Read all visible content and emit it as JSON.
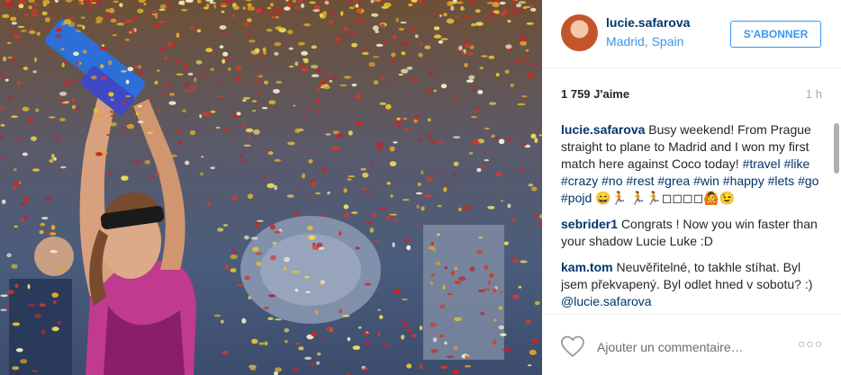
{
  "post": {
    "photo_alt": "",
    "username": "lucie.safarova",
    "location": "Madrid, Spain",
    "follow_label": "S'ABONNER",
    "likes": "1 759 J'aime",
    "time": "1 h"
  },
  "comments": [
    {
      "user": "lucie.safarova",
      "text_before": "Busy weekend! From Prague straight to plane to Madrid and I won my first match here against Coco today! ",
      "tags": [
        "#travel",
        "#like",
        "#crazy",
        "#no",
        "#rest",
        "#grea",
        "#win",
        "#happy",
        "#lets",
        "#go",
        "#pojd"
      ],
      "text_after": " 😄🏃 🏃🏃◻◻◻◻🙆😉"
    },
    {
      "user": "sebrider1",
      "text": "Congrats ! Now you win faster than your shadow Lucie Luke :D"
    },
    {
      "user": "kam.tom",
      "text": "Neuvěřitelné, to takhle stíhat. Byl jsem překvapený. Byl odlet hned v sobotu? :) ",
      "mention": "@lucie.safarova"
    }
  ],
  "footer": {
    "comment_placeholder": "Ajouter un commentaire…",
    "more_label": "○○○"
  },
  "icons": {
    "heart": "heart-icon",
    "more": "more-options-icon"
  },
  "colors": {
    "username": "#003569",
    "link": "#3897f0",
    "muted": "#a5a7aa"
  }
}
